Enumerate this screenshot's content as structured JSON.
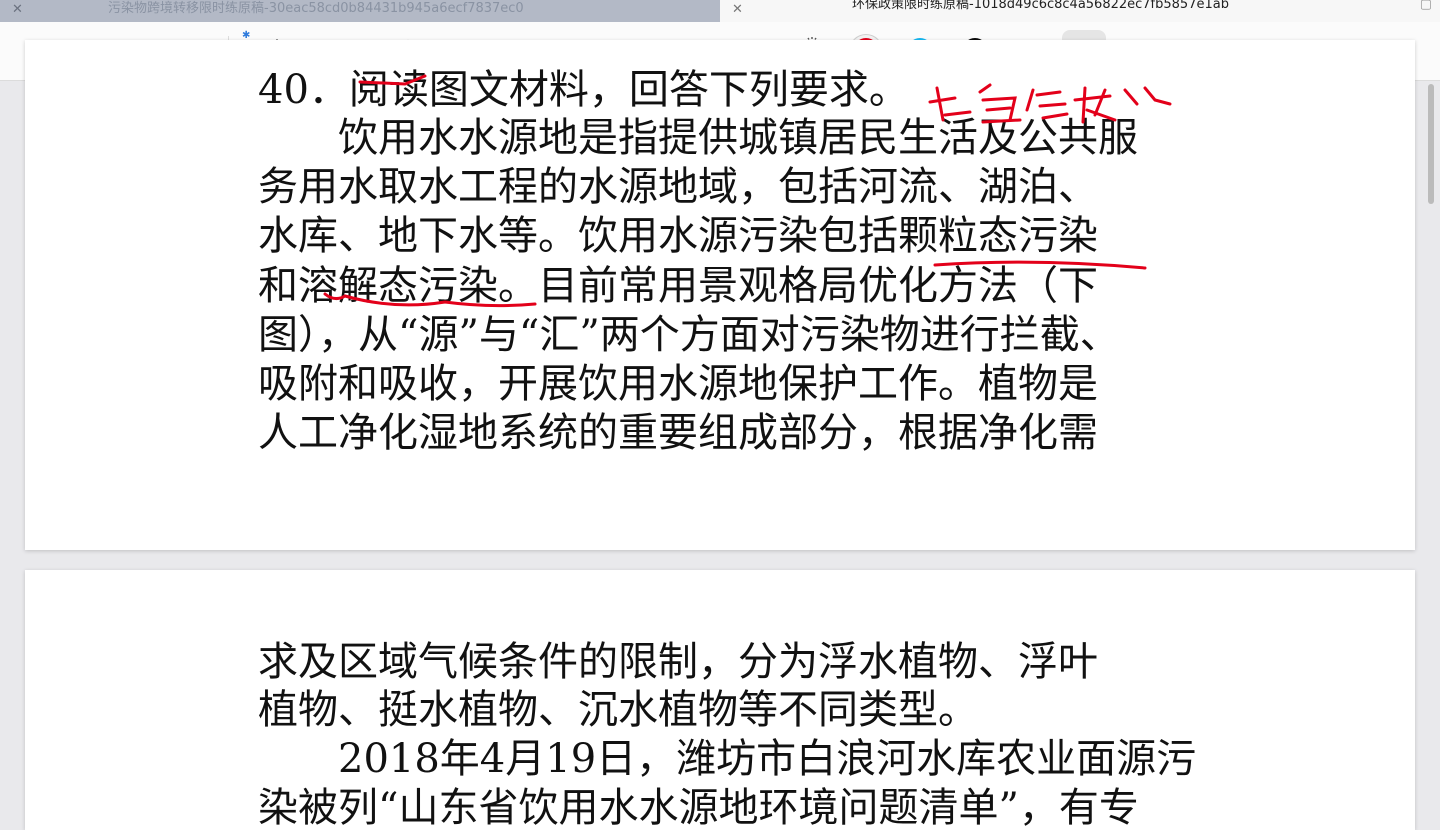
{
  "tabs": [
    {
      "title": "污染物跨境转移限时练原稿-30eac58cd0b84431b945a6ecf7837ec0",
      "active": false
    },
    {
      "title": "环保政策限时练原稿-1018d49c6c8c4a56822ec7fb5857e1ab",
      "active": true
    }
  ],
  "toolbar": {
    "tools": [
      "page-view-icon",
      "pen-icon",
      "eraser-icon",
      "highlighter-icon",
      "shapes-icon",
      "lasso-icon",
      "sticker-icon",
      "image-icon",
      "text-icon",
      "laser-pointer-icon"
    ],
    "colors": [
      "#e3001a",
      "#17b9f2",
      "#0b0b0b"
    ],
    "stroke_sizes": [
      "thin",
      "medium",
      "thick"
    ],
    "selected_stroke": "medium"
  },
  "page1": {
    "lines": [
      "40．阅读图文材料，回答下列要求。",
      "　　饮用水水源地是指提供城镇居民生活及公共服",
      "务用水取水工程的水源地域，包括河流、湖泊、",
      "水库、地下水等。饮用水源污染包括颗粒态污染",
      "和溶解态污染。目前常用景观格局优化方法（下",
      "图），从“源”与“汇”两个方面对污染物进行拦截、",
      "吸附和吸收，开展饮用水源地保护工作。植物是",
      "人工净化湿地系统的重要组成部分，根据净化需"
    ]
  },
  "page2": {
    "lines": [
      "求及区域气候条件的限制，分为浮水植物、浮叶",
      "植物、挺水植物、沉水植物等不同类型。",
      "　　2018年4月19日，潍坊市白浪河水库农业面源污",
      "染被列“山东省饮用水水源地环境问题清单”，有专"
    ]
  },
  "annotation": {
    "color": "#e3001a",
    "handwriting": "要求信息"
  }
}
